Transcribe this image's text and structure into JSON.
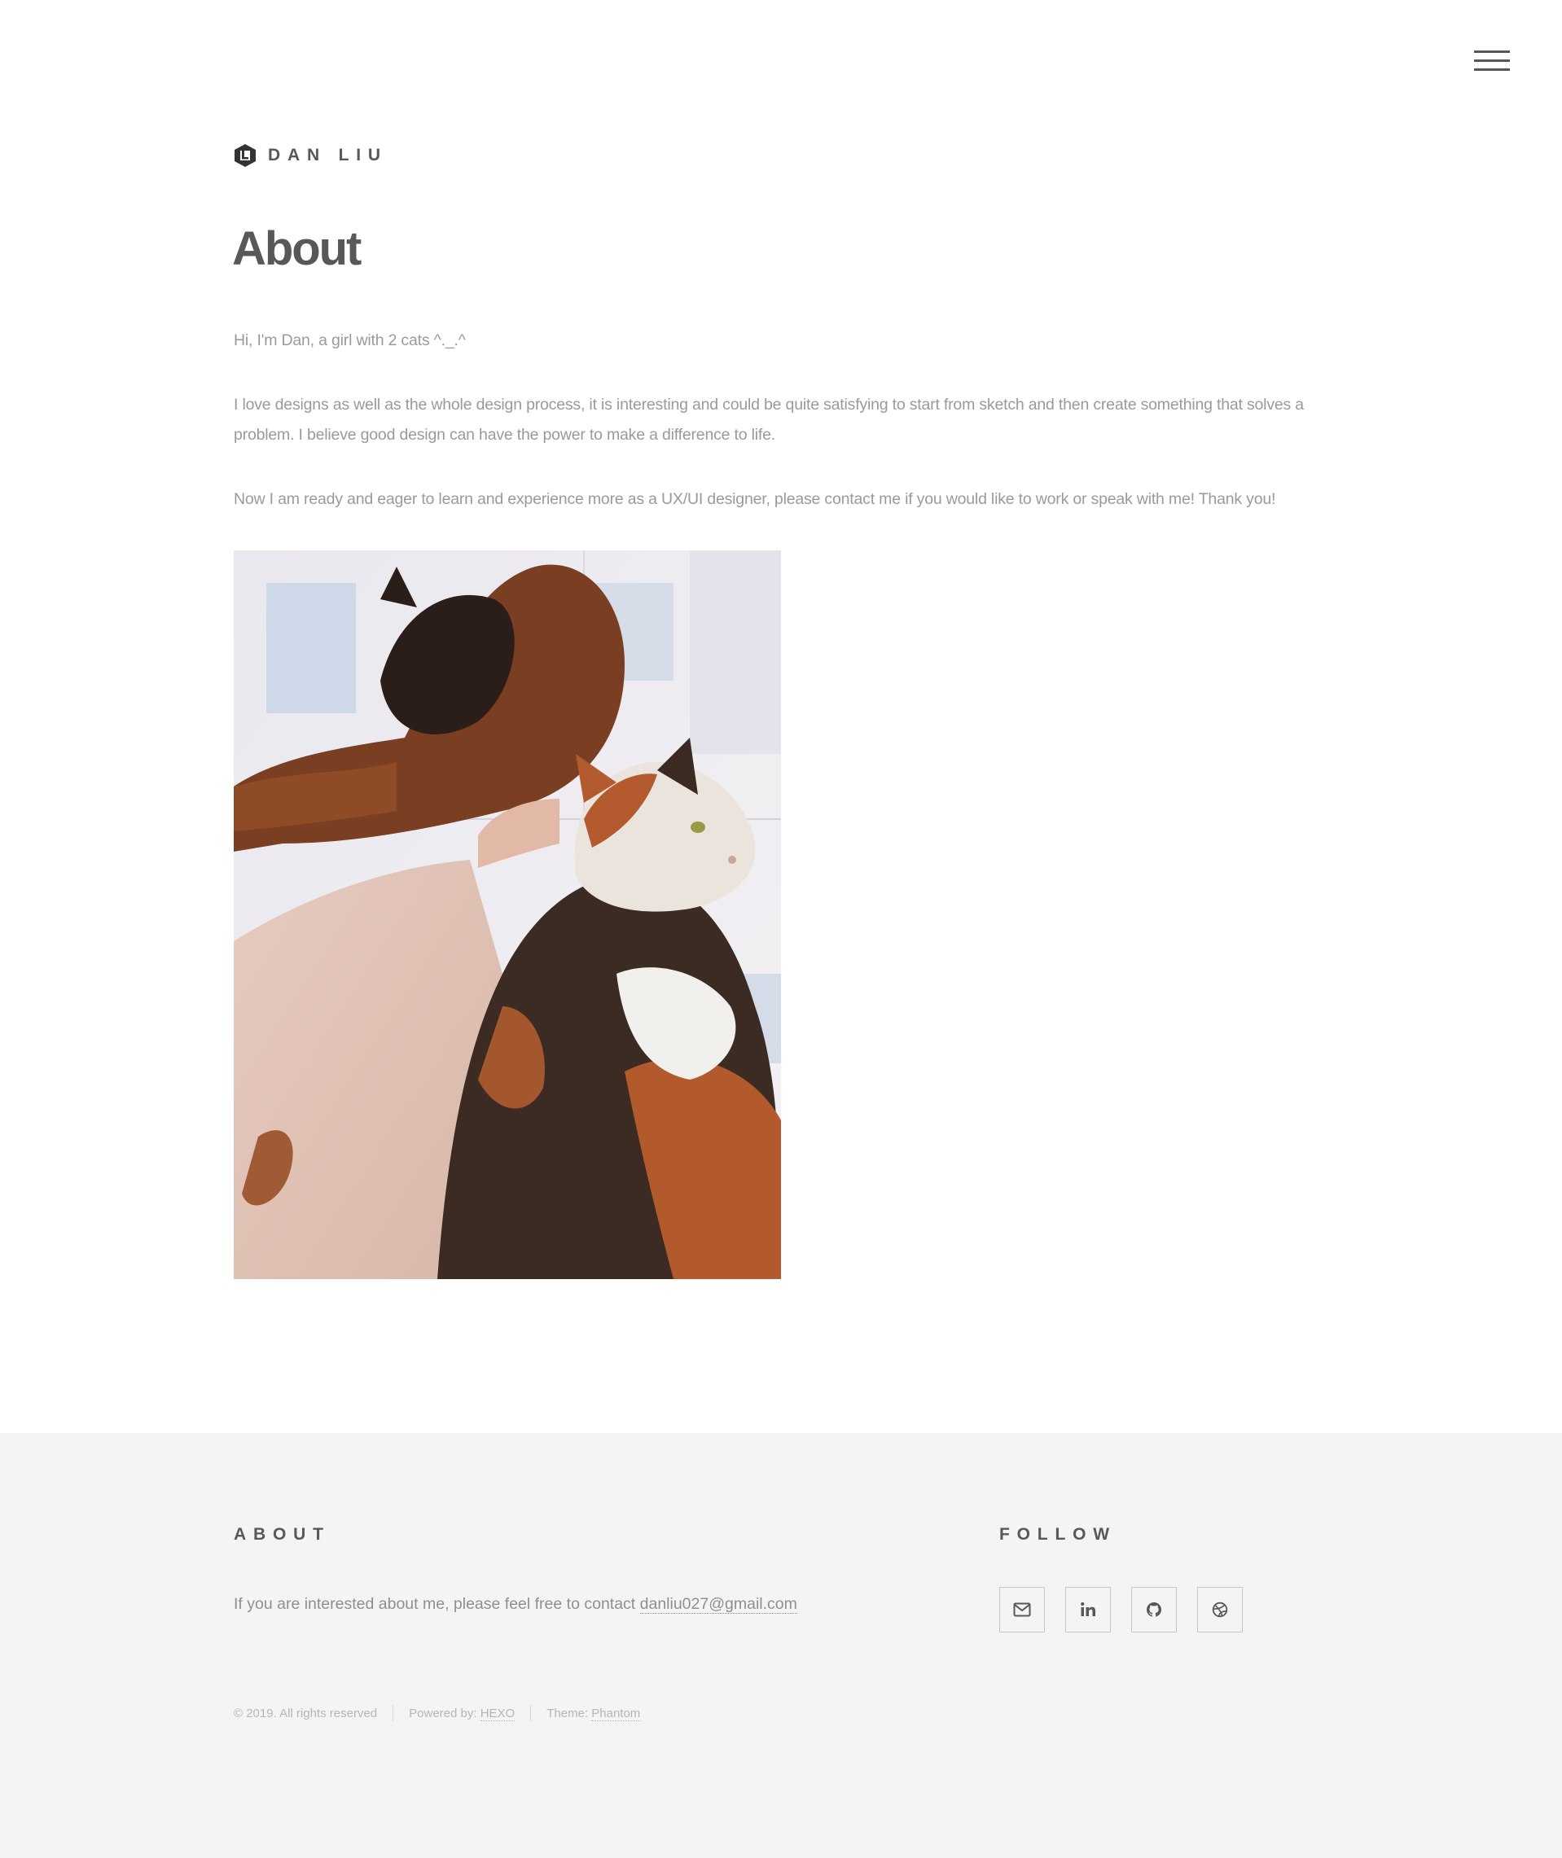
{
  "header": {
    "site_title": "DAN LIU",
    "logo_icon": "hexagon-logo-icon",
    "menu_icon": "hamburger-menu-icon"
  },
  "main": {
    "title": "About",
    "paragraphs": [
      "Hi, I'm Dan, a girl with 2 cats ^._.^",
      "I love designs as well as the whole design process, it is interesting and could be quite satisfying to start from sketch and then create something that solves a problem. I believe good design can have the power to make a difference to life.",
      "Now I am ready and eager to learn and experience more as a UX/UI designer, please contact me if you would like to work or speak with me! Thank you!"
    ],
    "photo_subject": "two cats on a bed"
  },
  "footer": {
    "about": {
      "heading": "ABOUT",
      "text": "If you are interested about me, please feel free to contact",
      "email": "danliu027@gmail.com"
    },
    "follow": {
      "heading": "FOLLOW",
      "icons": [
        "email-icon",
        "linkedin-icon",
        "github-icon",
        "dribbble-icon"
      ]
    },
    "copyright": {
      "text": "© 2019. All rights reserved",
      "powered_label": "Powered by:",
      "powered_link": "HEXO",
      "theme_label": "Theme:",
      "theme_link": "Phantom"
    }
  },
  "colors": {
    "text_dark": "#585858",
    "text_light": "#9a9a9a",
    "footer_bg": "#f4f4f4"
  }
}
